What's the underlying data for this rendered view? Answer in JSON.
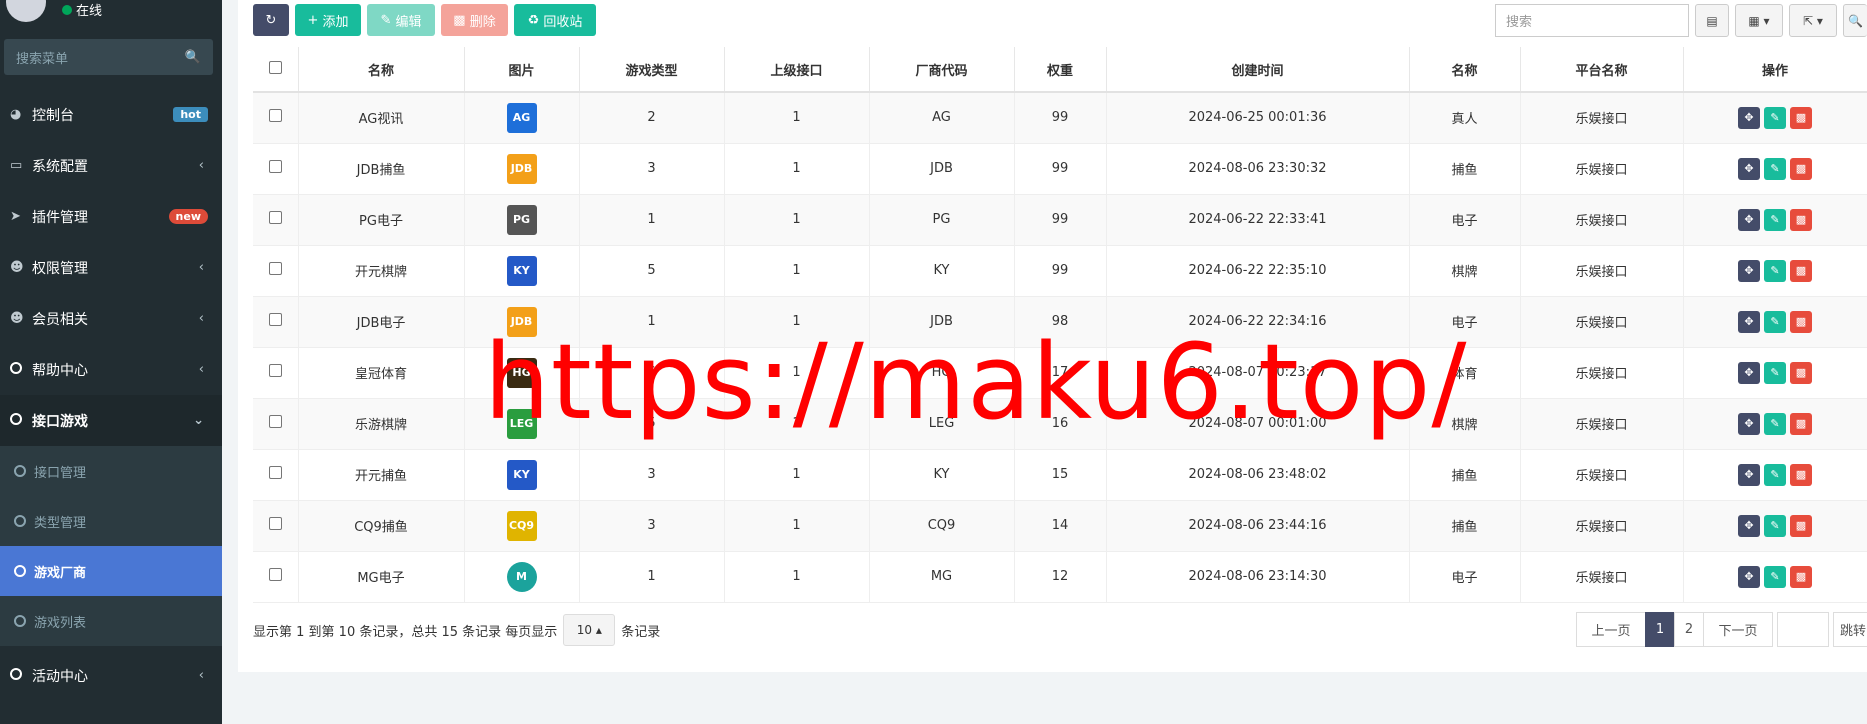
{
  "sidebar": {
    "status": "在线",
    "search_placeholder": "搜索菜单",
    "items": [
      {
        "label": "控制台",
        "badge": "hot"
      },
      {
        "label": "系统配置"
      },
      {
        "label": "插件管理",
        "badge": "new"
      },
      {
        "label": "权限管理"
      },
      {
        "label": "会员相关"
      },
      {
        "label": "帮助中心"
      },
      {
        "label": "接口游戏"
      }
    ],
    "subitems": [
      {
        "label": "接口管理"
      },
      {
        "label": "类型管理"
      },
      {
        "label": "游戏厂商"
      },
      {
        "label": "游戏列表"
      }
    ],
    "after_items": [
      {
        "label": "活动中心"
      }
    ]
  },
  "toolbar": {
    "add_label": "添加",
    "edit_label": "编辑",
    "delete_label": "删除",
    "recycle_label": "回收站",
    "search_placeholder": "搜索"
  },
  "table": {
    "headers": [
      "名称",
      "图片",
      "游戏类型",
      "上级接口",
      "厂商代码",
      "权重",
      "创建时间",
      "名称",
      "平台名称",
      "操作"
    ],
    "rows": [
      {
        "name": "AG视讯",
        "logo": "AG",
        "type": "2",
        "parent": "1",
        "code": "AG",
        "weight": "99",
        "created": "2024-06-25 00:01:36",
        "cat": "真人",
        "platform": "乐娱接口"
      },
      {
        "name": "JDB捕鱼",
        "logo": "JDB",
        "type": "3",
        "parent": "1",
        "code": "JDB",
        "weight": "99",
        "created": "2024-08-06 23:30:32",
        "cat": "捕鱼",
        "platform": "乐娱接口"
      },
      {
        "name": "PG电子",
        "logo": "PG",
        "type": "1",
        "parent": "1",
        "code": "PG",
        "weight": "99",
        "created": "2024-06-22 22:33:41",
        "cat": "电子",
        "platform": "乐娱接口"
      },
      {
        "name": "开元棋牌",
        "logo": "KY",
        "type": "5",
        "parent": "1",
        "code": "KY",
        "weight": "99",
        "created": "2024-06-22 22:35:10",
        "cat": "棋牌",
        "platform": "乐娱接口"
      },
      {
        "name": "JDB电子",
        "logo": "JDB",
        "type": "1",
        "parent": "1",
        "code": "JDB",
        "weight": "98",
        "created": "2024-06-22 22:34:16",
        "cat": "电子",
        "platform": "乐娱接口"
      },
      {
        "name": "皇冠体育",
        "logo": "HG",
        "type": "6",
        "parent": "1",
        "code": "HG",
        "weight": "17",
        "created": "2024-08-07 00:23:17",
        "cat": "体育",
        "platform": "乐娱接口"
      },
      {
        "name": "乐游棋牌",
        "logo": "LEG",
        "type": "5",
        "parent": "1",
        "code": "LEG",
        "weight": "16",
        "created": "2024-08-07 00:01:00",
        "cat": "棋牌",
        "platform": "乐娱接口"
      },
      {
        "name": "开元捕鱼",
        "logo": "KY",
        "type": "3",
        "parent": "1",
        "code": "KY",
        "weight": "15",
        "created": "2024-08-06 23:48:02",
        "cat": "捕鱼",
        "platform": "乐娱接口"
      },
      {
        "name": "CQ9捕鱼",
        "logo": "CQ9",
        "type": "3",
        "parent": "1",
        "code": "CQ9",
        "weight": "14",
        "created": "2024-08-06 23:44:16",
        "cat": "捕鱼",
        "platform": "乐娱接口"
      },
      {
        "name": "MG电子",
        "logo": "M",
        "type": "1",
        "parent": "1",
        "code": "MG",
        "weight": "12",
        "created": "2024-08-06 23:14:30",
        "cat": "电子",
        "platform": "乐娱接口"
      }
    ]
  },
  "footer": {
    "info_prefix": "显示第 1 到第 10 条记录，总共 15 条记录 每页显示",
    "page_size": "10",
    "info_suffix": "条记录",
    "prev": "上一页",
    "pages": [
      "1",
      "2"
    ],
    "next": "下一页",
    "jump": "跳转"
  },
  "watermark": "https://maku6.top/",
  "colors": {
    "sidebar_bg": "#222d32",
    "active_blue": "#4a77d4",
    "teal": "#18bc9c",
    "red": "#e74c3c",
    "slate": "#444c69"
  }
}
